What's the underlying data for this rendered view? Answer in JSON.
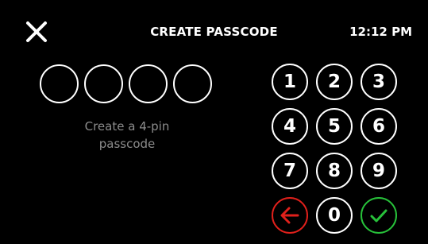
{
  "header": {
    "close_icon": "close-icon",
    "title": "CREATE PASSCODE",
    "time": "12:12 PM"
  },
  "pin": {
    "length": 4,
    "filled": 0,
    "prompt_line1": "Create a 4-pin",
    "prompt_line2": "passcode"
  },
  "keypad": {
    "keys": [
      "1",
      "2",
      "3",
      "4",
      "5",
      "6",
      "7",
      "8",
      "9"
    ],
    "zero": "0",
    "back_icon": "arrow-left-icon",
    "confirm_icon": "check-icon"
  },
  "colors": {
    "background": "#000000",
    "foreground": "#ffffff",
    "prompt": "#8c8c8c",
    "back": "#e0201b",
    "confirm": "#27c13a"
  }
}
